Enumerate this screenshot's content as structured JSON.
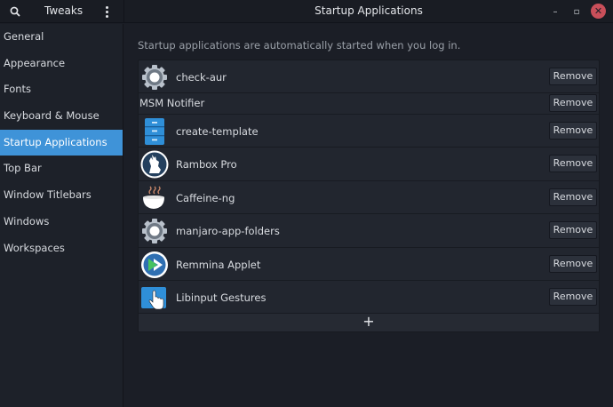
{
  "header": {
    "app_title": "Tweaks",
    "window_title": "Startup Applications",
    "search_icon": "search-icon",
    "menu_icon": "vertical-dots-icon"
  },
  "window_controls": {
    "minimize": "–",
    "maximize": "▫",
    "close": "✕"
  },
  "sidebar": {
    "items": [
      {
        "label": "General"
      },
      {
        "label": "Appearance"
      },
      {
        "label": "Fonts"
      },
      {
        "label": "Keyboard & Mouse"
      },
      {
        "label": "Startup Applications",
        "active": true
      },
      {
        "label": "Top Bar"
      },
      {
        "label": "Window Titlebars"
      },
      {
        "label": "Windows"
      },
      {
        "label": "Workspaces"
      }
    ]
  },
  "main": {
    "hint": "Startup applications are automatically started when you log in.",
    "remove_label": "Remove",
    "add_label": "+",
    "apps": [
      {
        "name": "check-aur",
        "icon": "gear-icon"
      },
      {
        "name": "MSM Notifier",
        "icon": ""
      },
      {
        "name": "create-template",
        "icon": "file-cabinet-icon"
      },
      {
        "name": "Rambox Pro",
        "icon": "goat-logo-icon"
      },
      {
        "name": "Caffeine-ng",
        "icon": "coffee-cup-icon"
      },
      {
        "name": "manjaro-app-folders",
        "icon": "gear-icon"
      },
      {
        "name": "Remmina Applet",
        "icon": "remmina-icon"
      },
      {
        "name": "Libinput Gestures",
        "icon": "touch-hand-icon"
      }
    ]
  },
  "colors": {
    "accent": "#3f93d8",
    "background": "#1b1e26",
    "sidebar": "#1d2129",
    "list": "#22262f",
    "close": "#c94f5a"
  }
}
